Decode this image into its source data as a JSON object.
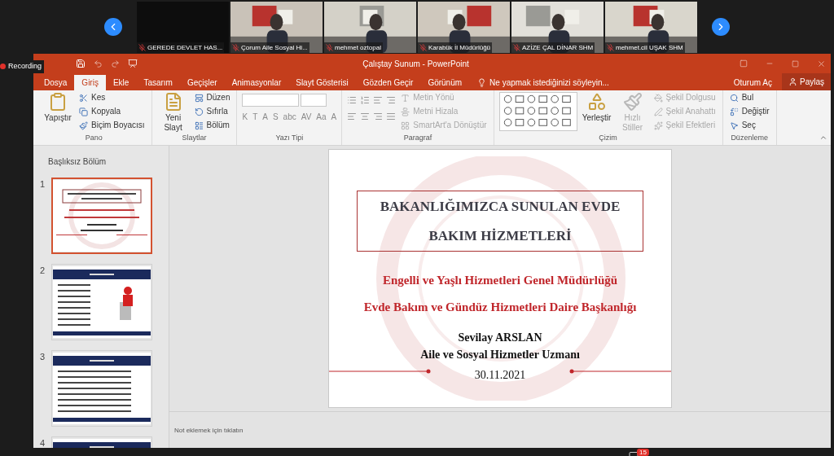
{
  "conference": {
    "recording": "Recording",
    "chat_badge": "15",
    "tiles": [
      {
        "name": "GEREDE DEVLET HAS...",
        "kind": "camera_off"
      },
      {
        "name": "Çorum Aile Sosyal Hi...",
        "kind": "video"
      },
      {
        "name": "mehmet oztopal",
        "kind": "video"
      },
      {
        "name": "Karabük İl Müdürlüğü",
        "kind": "video"
      },
      {
        "name": "AZİZE ÇAL DİNAR SHM",
        "kind": "video"
      },
      {
        "name": "mehmet.cil UŞAK SHM",
        "kind": "video"
      }
    ]
  },
  "window": {
    "title": "Çalıştay Sunum - PowerPoint"
  },
  "tabs": [
    {
      "label": "Dosya",
      "selected": false
    },
    {
      "label": "Giriş",
      "selected": true
    },
    {
      "label": "Ekle",
      "selected": false
    },
    {
      "label": "Tasarım",
      "selected": false
    },
    {
      "label": "Geçişler",
      "selected": false
    },
    {
      "label": "Animasyonlar",
      "selected": false
    },
    {
      "label": "Slayt Gösterisi",
      "selected": false
    },
    {
      "label": "Gözden Geçir",
      "selected": false
    },
    {
      "label": "Görünüm",
      "selected": false
    }
  ],
  "tell_me": "Ne yapmak istediğinizi söyleyin...",
  "sign_in": "Oturum Aç",
  "share": "Paylaş",
  "ribbon": [
    {
      "label": "Pano",
      "kind": "clipboard",
      "big": [
        {
          "label": "Yapıştır",
          "disabled": false
        }
      ],
      "small": [
        {
          "label": "Kes",
          "disabled": false
        },
        {
          "label": "Kopyala",
          "disabled": false
        },
        {
          "label": "Biçim Boyacısı",
          "disabled": false
        }
      ]
    },
    {
      "label": "Slaytlar",
      "kind": "slides",
      "big": [
        {
          "label": "Yeni Slayt",
          "disabled": false
        }
      ],
      "small": [
        {
          "label": "Düzen",
          "disabled": false
        },
        {
          "label": "Sıfırla",
          "disabled": false
        },
        {
          "label": "Bölüm",
          "disabled": false
        }
      ]
    },
    {
      "label": "Yazı Tipi",
      "kind": "font",
      "buttons": [
        "K",
        "T",
        "A",
        "S",
        "abc",
        "AV",
        "Aa",
        "A"
      ]
    },
    {
      "label": "Paragraf",
      "kind": "paragraph",
      "small": [
        {
          "label": "Metin Yönü",
          "disabled": true
        },
        {
          "label": "Metni Hizala",
          "disabled": true
        },
        {
          "label": "SmartArt'a Dönüştür",
          "disabled": true
        }
      ]
    },
    {
      "label": "Çizim",
      "kind": "drawing",
      "big": [
        {
          "label": "Yerleştir",
          "disabled": false
        },
        {
          "label": "Hızlı Stiller",
          "disabled": true
        }
      ],
      "small": [
        {
          "label": "Şekil Dolgusu",
          "disabled": true
        },
        {
          "label": "Şekil Anahattı",
          "disabled": true
        },
        {
          "label": "Şekil Efektleri",
          "disabled": true
        }
      ]
    },
    {
      "label": "Düzenleme",
      "kind": "editing",
      "small": [
        {
          "label": "Bul",
          "disabled": false
        },
        {
          "label": "Değiştir",
          "disabled": false
        },
        {
          "label": "Seç",
          "disabled": false
        }
      ]
    }
  ],
  "slide_panel": {
    "section": "Başlıksız Bölüm",
    "thumbnails": [
      {
        "number": "1",
        "kind": "title",
        "selected": true
      },
      {
        "number": "2",
        "kind": "plan",
        "selected": false
      },
      {
        "number": "3",
        "kind": "text",
        "selected": false
      },
      {
        "number": "4",
        "kind": "text",
        "selected": false
      }
    ]
  },
  "slide": {
    "title_lines": [
      "BAKANLIĞIMIZCA SUNULAN EVDE",
      "BAKIM HİZMETLERİ"
    ],
    "subtitles": [
      "Engelli ve Yaşlı Hizmetleri Genel Müdürlüğü",
      "Evde Bakım ve Gündüz Hizmetleri Daire Başkanlığı"
    ],
    "presenter": "Sevilay ARSLAN",
    "role": "Aile ve Sosyal Hizmetler Uzmanı",
    "date": "30.11.2021"
  },
  "notes_placeholder": "Not eklemek için tıklatın"
}
